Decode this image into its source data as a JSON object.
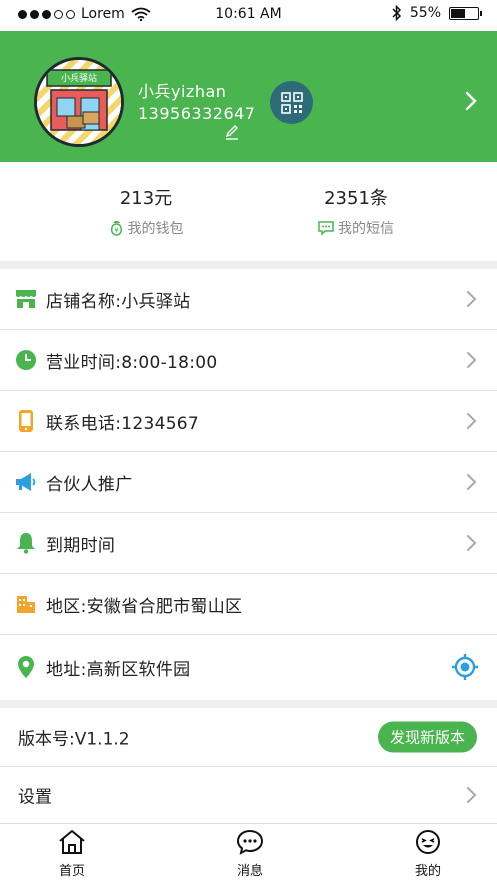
{
  "status_bar": {
    "carrier": "Lorem",
    "time": "10:61 AM",
    "battery": "55%",
    "battery_level": 0.55
  },
  "header": {
    "avatar_sign": "小兵驿站",
    "user_name": "小兵yizhan",
    "phone": "13956332647",
    "bg_color": "#4ab54f"
  },
  "stats": [
    {
      "value": "213元",
      "label": "我的钱包",
      "icon": "wallet-icon"
    },
    {
      "value": "2351条",
      "label": "我的短信",
      "icon": "message-icon"
    }
  ],
  "list": [
    {
      "label": "店铺名称:小兵驿站",
      "icon": "store-icon",
      "has_arrow": true
    },
    {
      "label": "营业时间:8:00-18:00",
      "icon": "clock-icon",
      "has_arrow": true
    },
    {
      "label": "联系电话:1234567",
      "icon": "phone-icon",
      "has_arrow": true
    },
    {
      "label": "合伙人推广",
      "icon": "megaphone-icon",
      "has_arrow": true
    },
    {
      "label": "到期时间",
      "icon": "bell-icon",
      "has_arrow": true
    },
    {
      "label": "地区:安徽省合肥市蜀山区",
      "icon": "building-icon",
      "has_arrow": false
    },
    {
      "label": "地址:高新区软件园",
      "icon": "location-pin-icon",
      "has_arrow": false
    }
  ],
  "version": {
    "label": "版本号:V1.1.2",
    "button": "发现新版本"
  },
  "settings": {
    "label": "设置"
  },
  "tabs": [
    {
      "label": "首页",
      "icon": "home-icon"
    },
    {
      "label": "消息",
      "icon": "chat-icon"
    },
    {
      "label": "我的",
      "icon": "smiley-icon"
    }
  ]
}
